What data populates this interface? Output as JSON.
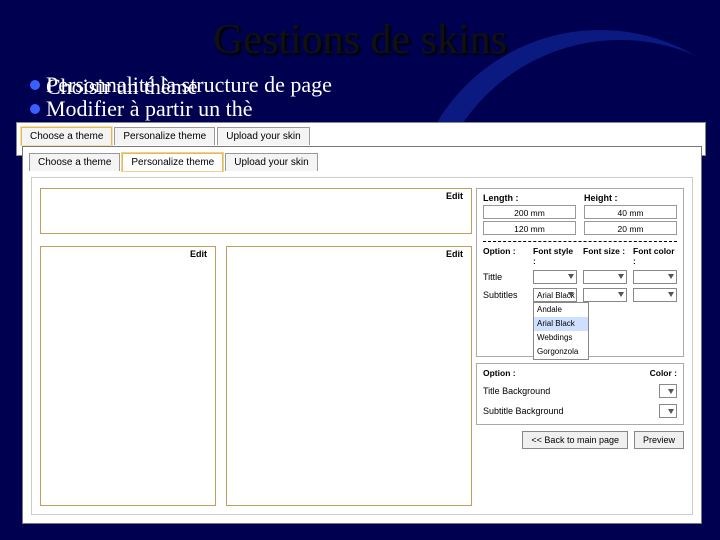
{
  "slide": {
    "title": "Gestions de skins",
    "bullet1a": "Personnalité la structure de page",
    "bullet1b": "Choisir un thème",
    "bullet2": "Modifier à partir un thè"
  },
  "tabs": {
    "choose": "Choose a theme",
    "personalize": "Personalize theme",
    "upload": "Upload your skin"
  },
  "layout": {
    "edit": "Edit"
  },
  "props": {
    "length_label": "Length :",
    "length1": "200 mm",
    "length2": "120 mm",
    "height_label": "Height :",
    "height1": "40 mm",
    "height2": "20 mm",
    "option_hdr": "Option :",
    "fontstyle_hdr": "Font style :",
    "fontsize_hdr": "Font size :",
    "fontcolor_hdr": "Font color :",
    "row_title": "Tittle",
    "row_subtitle": "Subtitles",
    "dd_selected": "Arial Black",
    "dd_opts": [
      "Andale",
      "Arial Black",
      "Webdings",
      "Gorgonzola",
      "..."
    ],
    "color_hdr": "Color :",
    "bg_title": "Title Background",
    "bg_subtitle": "Subtitle Background",
    "back": "<< Back to main page",
    "preview": "Preview"
  }
}
